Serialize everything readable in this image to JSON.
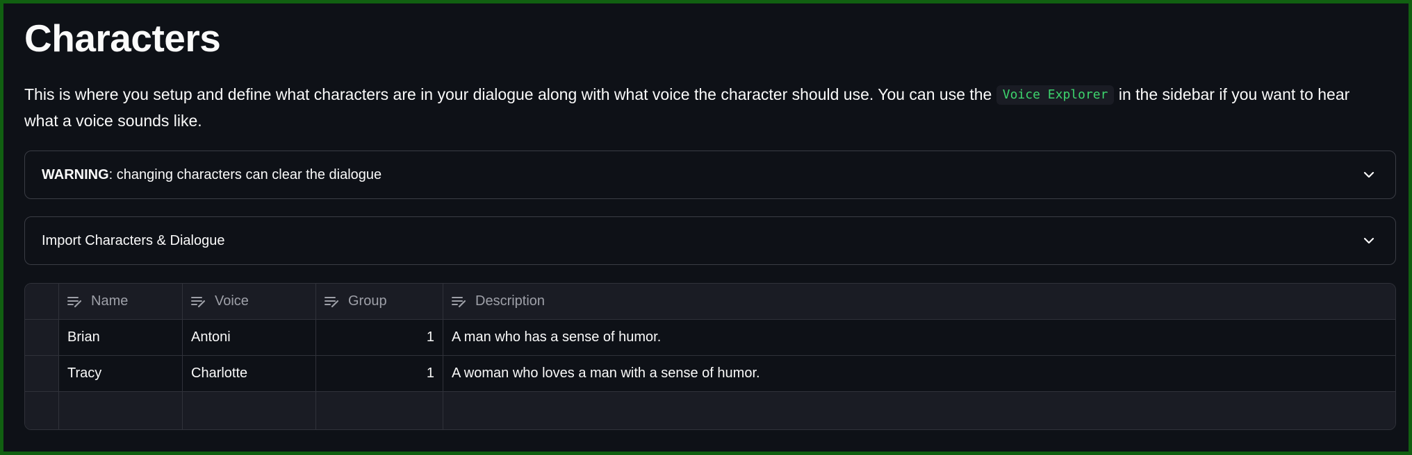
{
  "page": {
    "title": "Characters",
    "intro_before": "This is where you setup and define what characters are in your dialogue along with what voice the character should use. You can use the ",
    "intro_code": "Voice Explorer",
    "intro_after": " in the sidebar if you want to hear what a voice sounds like."
  },
  "expanders": {
    "warning": {
      "bold": "WARNING",
      "text": ": changing characters can clear the dialogue",
      "icon": "chevron-down-icon"
    },
    "import": {
      "label": "Import Characters & Dialogue",
      "icon": "chevron-down-icon"
    }
  },
  "table": {
    "columns": [
      "Name",
      "Voice",
      "Group",
      "Description"
    ],
    "column_icon": "editable-text-icon",
    "rows": [
      {
        "name": "Brian",
        "voice": "Antoni",
        "group": "1",
        "description": "A man who has a sense of humor."
      },
      {
        "name": "Tracy",
        "voice": "Charlotte",
        "group": "1",
        "description": "A woman who loves a man with a sense of humor."
      }
    ]
  },
  "colors": {
    "background": "#0e1117",
    "frame_border": "#116011",
    "code_text": "#3dd56d",
    "border": "#3b3d45"
  }
}
